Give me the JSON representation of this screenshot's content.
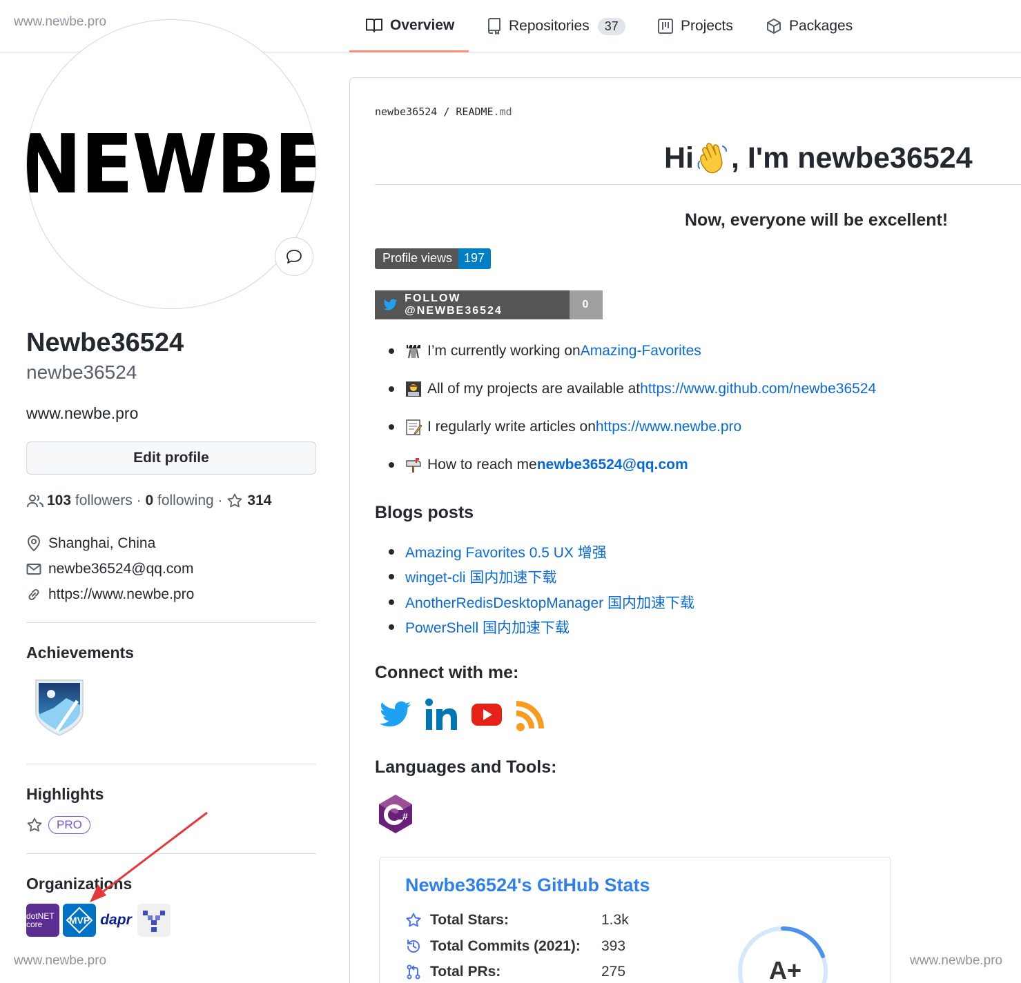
{
  "watermark": "www.newbe.pro",
  "nav": {
    "tabs": [
      {
        "label": "Overview",
        "icon": "book-icon",
        "active": true
      },
      {
        "label": "Repositories",
        "icon": "repo-icon",
        "count": "37"
      },
      {
        "label": "Projects",
        "icon": "project-icon"
      },
      {
        "label": "Packages",
        "icon": "package-icon"
      }
    ]
  },
  "profile": {
    "avatar_text": "NEWBE",
    "name": "Newbe36524",
    "login": "newbe36524",
    "bio": "www.newbe.pro",
    "edit_label": "Edit profile",
    "followers_count": "103",
    "followers_label": "followers",
    "sep": "·",
    "following_count": "0",
    "following_label": "following",
    "stars_count": "314",
    "location": "Shanghai, China",
    "email": "newbe36524@qq.com",
    "website": "https://www.newbe.pro"
  },
  "sections": {
    "achievements": "Achievements",
    "highlights": "Highlights",
    "pro_badge": "PRO",
    "organizations": "Organizations"
  },
  "orgs": [
    "dotNET core",
    "MVP",
    "dapr",
    "pixel-org"
  ],
  "readme": {
    "path_user": "newbe36524",
    "path_sep": " / ",
    "path_file": "README",
    "path_ext": ".md",
    "heading_pre": "Hi ",
    "heading_post": ", I'm newbe36524",
    "tagline": "Now, everyone will be excellent!",
    "profile_views_label": "Profile views",
    "profile_views_count": "197",
    "twitter_follow": "FOLLOW @NEWBE36524",
    "twitter_count": "0",
    "bullets": [
      {
        "text": "I’m currently working on ",
        "link": "Amazing-Favorites"
      },
      {
        "text": "All of my projects are available at ",
        "link": "https://www.github.com/newbe36524"
      },
      {
        "text": "I regularly write articles on ",
        "link": "https://www.newbe.pro"
      },
      {
        "text": "How to reach me ",
        "link": "newbe36524@qq.com"
      }
    ],
    "blogs_heading": "Blogs posts",
    "blogs": [
      "Amazing Favorites 0.5 UX 增强",
      "winget-cli 国内加速下载",
      "AnotherRedisDesktopManager 国内加速下载",
      "PowerShell 国内加速下载"
    ],
    "connect_heading": "Connect with me:",
    "languages_heading": "Languages and Tools:"
  },
  "stats": {
    "title": "Newbe36524's GitHub Stats",
    "rows": [
      {
        "label": "Total Stars:",
        "value": "1.3k"
      },
      {
        "label": "Total Commits (2021):",
        "value": "393"
      },
      {
        "label": "Total PRs:",
        "value": "275"
      }
    ],
    "grade": "A+"
  },
  "colors": {
    "accent": "#fd8c73",
    "link": "#0969da",
    "stats_title": "#2f80ed",
    "pro": "#8250df"
  }
}
